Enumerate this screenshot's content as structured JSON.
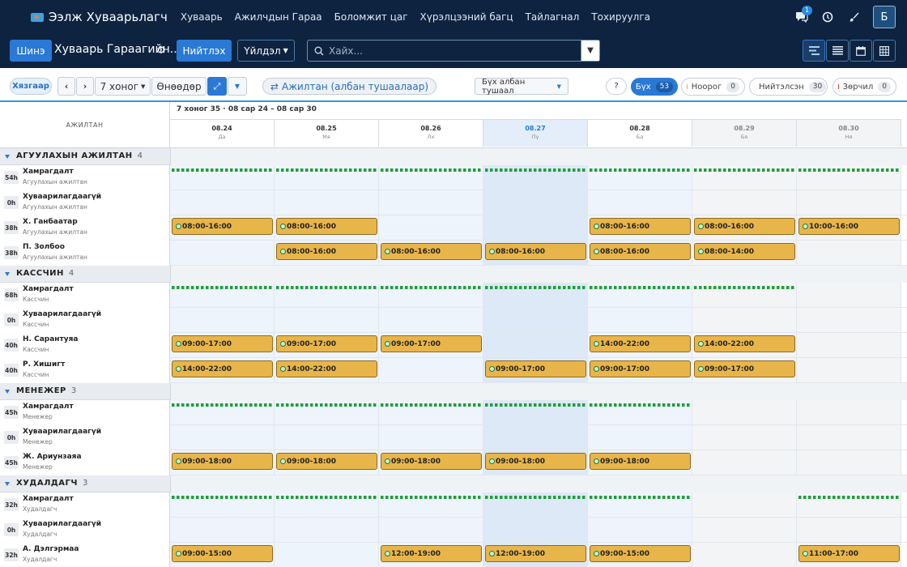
{
  "app": {
    "title": "Ээлж Хуваарьлагч"
  },
  "nav": [
    "Хуваарь",
    "Ажилчдын Гараа",
    "Боломжит цаг",
    "Хүрэлцээний багц",
    "Тайлагнал",
    "Тохируулга"
  ],
  "topright": {
    "messages_badge": "1",
    "avatar_letter": "Б"
  },
  "bar": {
    "new_label": "Шинэ",
    "schedule_title": "Хуваарь Гараагийн...",
    "publish_label": "Нийтлэх",
    "actions_label": "Үйлдэл",
    "search_placeholder": "Хайх..."
  },
  "toolbar": {
    "today_tag": "Хязгаар",
    "period_label": "7 хоног",
    "today_label": "Өнөөдөр",
    "group_label": "Ажилтан (албан тушаалаар)",
    "position_filter": "Бүх албан тушаал",
    "help": "?"
  },
  "filters": [
    {
      "label": "Бүх",
      "count": "53",
      "color": ""
    },
    {
      "label": "Ноорог",
      "count": "0",
      "color": "#f0a24a"
    },
    {
      "label": "Нийтэлсэн",
      "count": "30",
      "color": "#29a35a"
    },
    {
      "label": "Зөрчил",
      "count": "0",
      "color": "#e0443b"
    }
  ],
  "grid": {
    "week_label": "7 хоног 35 · 08 сар 24 – 08 сар 30",
    "employee_header": "АЖИЛТАН",
    "days": [
      {
        "date": "08.24",
        "dow": "Да"
      },
      {
        "date": "08.25",
        "dow": "Мя"
      },
      {
        "date": "08.26",
        "dow": "Лх"
      },
      {
        "date": "08.27",
        "dow": "Пү"
      },
      {
        "date": "08.28",
        "dow": "Ба"
      },
      {
        "date": "08.29",
        "dow": "Бя"
      },
      {
        "date": "08.30",
        "dow": "Ня"
      }
    ],
    "today_index": 3,
    "groups": [
      {
        "title": "АГУУЛАХЫН АЖИЛТАН",
        "count": "4",
        "role": "Агуулахын ажилтан",
        "rows": [
          {
            "name": "Хамрагдалт",
            "hours": "54h",
            "coverage": [
              1,
              1,
              1,
              1,
              1,
              1,
              1
            ],
            "shifts": [
              null,
              null,
              null,
              null,
              null,
              null,
              null
            ]
          },
          {
            "name": "Хуваарилагдаагүй",
            "hours": "0h",
            "shifts": [
              null,
              null,
              null,
              null,
              null,
              null,
              null
            ]
          },
          {
            "name": "Х. Ганбаатар",
            "hours": "38h",
            "shifts": [
              "08:00-16:00",
              "08:00-16:00",
              null,
              null,
              "08:00-16:00",
              "08:00-16:00",
              "10:00-16:00"
            ]
          },
          {
            "name": "П. Золбоо",
            "hours": "38h",
            "shifts": [
              null,
              "08:00-16:00",
              "08:00-16:00",
              "08:00-16:00",
              "08:00-16:00",
              "08:00-14:00",
              null
            ]
          }
        ]
      },
      {
        "title": "КАССЧИН",
        "count": "4",
        "role": "Кассчин",
        "rows": [
          {
            "name": "Хамрагдалт",
            "hours": "68h",
            "coverage": [
              1,
              1,
              1,
              1,
              1,
              1,
              0
            ],
            "shifts": [
              null,
              null,
              null,
              null,
              null,
              null,
              null
            ]
          },
          {
            "name": "Хуваарилагдаагүй",
            "hours": "0h",
            "shifts": [
              null,
              null,
              null,
              null,
              null,
              null,
              null
            ]
          },
          {
            "name": "Н. Сарантуяа",
            "hours": "40h",
            "shifts": [
              "09:00-17:00",
              "09:00-17:00",
              "09:00-17:00",
              null,
              "14:00-22:00",
              "14:00-22:00",
              null
            ]
          },
          {
            "name": "Р. Хишигт",
            "hours": "40h",
            "shifts": [
              "14:00-22:00",
              "14:00-22:00",
              null,
              "09:00-17:00",
              "09:00-17:00",
              "09:00-17:00",
              null
            ]
          }
        ]
      },
      {
        "title": "МЕНЕЖЕР",
        "count": "3",
        "role": "Менежер",
        "rows": [
          {
            "name": "Хамрагдалт",
            "hours": "45h",
            "coverage": [
              1,
              1,
              1,
              1,
              1,
              0,
              0
            ],
            "shifts": [
              null,
              null,
              null,
              null,
              null,
              null,
              null
            ]
          },
          {
            "name": "Хуваарилагдаагүй",
            "hours": "0h",
            "shifts": [
              null,
              null,
              null,
              null,
              null,
              null,
              null
            ]
          },
          {
            "name": "Ж. Ариунзаяа",
            "hours": "45h",
            "shifts": [
              "09:00-18:00",
              "09:00-18:00",
              "09:00-18:00",
              "09:00-18:00",
              "09:00-18:00",
              null,
              null
            ]
          }
        ]
      },
      {
        "title": "ХУДАЛДАГЧ",
        "count": "3",
        "role": "Худалдагч",
        "rows": [
          {
            "name": "Хамрагдалт",
            "hours": "32h",
            "coverage": [
              1,
              1,
              1,
              1,
              1,
              0,
              1
            ],
            "shifts": [
              null,
              null,
              null,
              null,
              null,
              null,
              null
            ]
          },
          {
            "name": "Хуваарилагдаагүй",
            "hours": "0h",
            "shifts": [
              null,
              null,
              null,
              null,
              null,
              null,
              null
            ]
          },
          {
            "name": "А. Дэлгэрмаа",
            "hours": "32h",
            "shifts": [
              "09:00-15:00",
              null,
              "12:00-19:00",
              "12:00-19:00",
              "09:00-15:00",
              null,
              "11:00-17:00"
            ]
          }
        ]
      }
    ]
  }
}
